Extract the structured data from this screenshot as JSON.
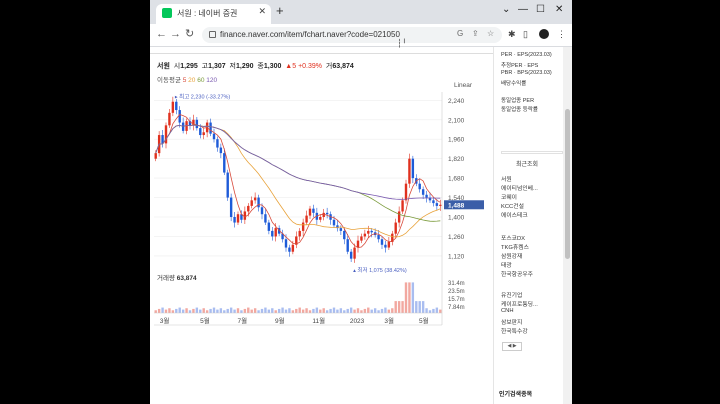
{
  "browser": {
    "tab_title": "서원 : 네이버 증권",
    "url": "finance.naver.com/item/fchart.naver?code=021050",
    "new_tab_glyph": "+",
    "close_glyph": "✕"
  },
  "quote": {
    "name": "서원",
    "open_label": "시",
    "open": "1,295",
    "high_label": "고",
    "high": "1,307",
    "low_label": "저",
    "low": "1,290",
    "close_label": "종",
    "close": "1,300",
    "change": "▲5",
    "change_pct": "+0.39%",
    "vol_label": "거",
    "volume": "63,874"
  },
  "moving_avg": {
    "label": "이동평균",
    "periods": [
      "5",
      "20",
      "60",
      "120"
    ]
  },
  "scale_label": "Linear",
  "chart_data": {
    "type": "candlestick",
    "x_ticks": [
      "3월",
      "5월",
      "7월",
      "9월",
      "11월",
      "2023",
      "3월",
      "5월"
    ],
    "y_ticks": [
      2240,
      2100,
      1960,
      1820,
      1680,
      1540,
      1400,
      1260,
      1120
    ],
    "ylim": [
      1040,
      2300
    ],
    "current_price": "1,488",
    "high_annotation": "최고 2,230 (-33.27%)",
    "low_annotation": "최저 1,075 (38.42%)",
    "volume_label": "거래량",
    "volume_value": "63,874",
    "volume_ticks": [
      "31.4m",
      "23.5m",
      "15.7m",
      "7.84m"
    ],
    "closes": [
      1860,
      1990,
      1930,
      2060,
      2150,
      2230,
      2170,
      2080,
      2020,
      2090,
      2060,
      2100,
      2040,
      1990,
      2010,
      2080,
      2000,
      1960,
      1900,
      1860,
      1720,
      1540,
      1400,
      1360,
      1420,
      1380,
      1440,
      1480,
      1520,
      1540,
      1470,
      1420,
      1360,
      1300,
      1260,
      1320,
      1280,
      1240,
      1180,
      1150,
      1200,
      1260,
      1300,
      1360,
      1410,
      1460,
      1430,
      1380,
      1400,
      1430,
      1420,
      1380,
      1340,
      1320,
      1300,
      1240,
      1150,
      1100,
      1180,
      1230,
      1260,
      1280,
      1300,
      1290,
      1270,
      1240,
      1200,
      1180,
      1220,
      1280,
      1360,
      1440,
      1520,
      1640,
      1820,
      1680,
      1640,
      1600,
      1560,
      1540,
      1520,
      1500,
      1480,
      1488
    ],
    "ma_colors": {
      "ma5": "#d84a3a",
      "ma20": "#e8a23a",
      "ma60": "#7a9a3a",
      "ma120": "#7a5ab0"
    },
    "colors": {
      "up": "#e0301e",
      "down": "#1e5bd8"
    }
  },
  "financials": {
    "per_eps": "PER · EPS(2023.03)",
    "est_per": "추정PER · EPS",
    "pbr_bps": "PBR · BPS(2023.03)",
    "dividend": "배당수익률",
    "same_industry": "동일업종 PER",
    "same_industry_change": "동일업종 등락률"
  },
  "recent_viewed": {
    "title": "최근조회",
    "group1": [
      "서원",
      "에이티넘인베...",
      "코웨이",
      "KCC건설",
      "에이스테크"
    ],
    "group2": [
      "포스코DX",
      "TKG휴켐스",
      "삼원강재",
      "태광",
      "한국항공우주"
    ],
    "group3": [
      "유진기업",
      "케이프로퉁딩...",
      "CNH",
      "삼보판지",
      "한국특수강"
    ],
    "pager": "◀ ▶"
  },
  "popular_title": "인기검색종목"
}
